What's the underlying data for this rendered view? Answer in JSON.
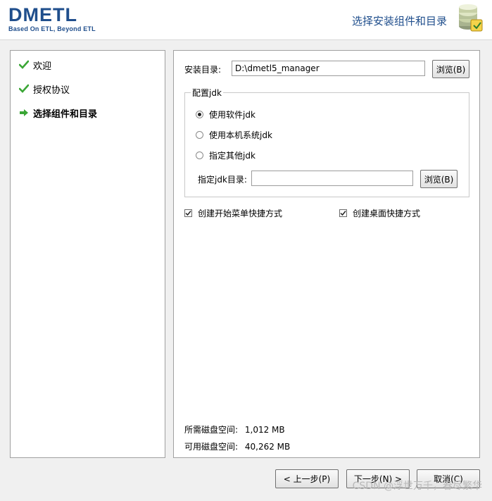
{
  "header": {
    "logo": "DMETL",
    "tagline": "Based On ETL, Beyond ETL",
    "title": "选择安装组件和目录",
    "icon": "database-install-icon"
  },
  "steps": [
    {
      "label": "欢迎",
      "state": "done",
      "icon": "check-icon"
    },
    {
      "label": "授权协议",
      "state": "done",
      "icon": "check-icon"
    },
    {
      "label": "选择组件和目录",
      "state": "current",
      "icon": "arrow-right-icon"
    }
  ],
  "install_dir": {
    "label": "安装目录:",
    "value": "D:\\dmetl5_manager",
    "browse_label": "浏览(B)"
  },
  "jdk_group": {
    "title": "配置jdk",
    "options": [
      {
        "label": "使用软件jdk",
        "selected": true
      },
      {
        "label": "使用本机系统jdk",
        "selected": false
      },
      {
        "label": "指定其他jdk",
        "selected": false
      }
    ],
    "dir_label": "指定jdk目录:",
    "dir_value": "",
    "browse_label": "浏览(B)"
  },
  "shortcuts": {
    "start_menu": {
      "label": "创建开始菜单快捷方式",
      "checked": true
    },
    "desktop": {
      "label": "创建桌面快捷方式",
      "checked": true
    }
  },
  "disk": {
    "required_label": "所需磁盘空间:",
    "required_value": "1,012 MB",
    "available_label": "可用磁盘空间:",
    "available_value": "40,262 MB"
  },
  "footer": {
    "back_label": "< 上一步(P)",
    "next_label": "下一步(N) >",
    "cancel_label": "取消(C)"
  },
  "watermark": "CSDN @浮世万千，春尽繁华",
  "colors": {
    "brand_blue": "#1f4e8c",
    "check_green": "#3aa635"
  }
}
